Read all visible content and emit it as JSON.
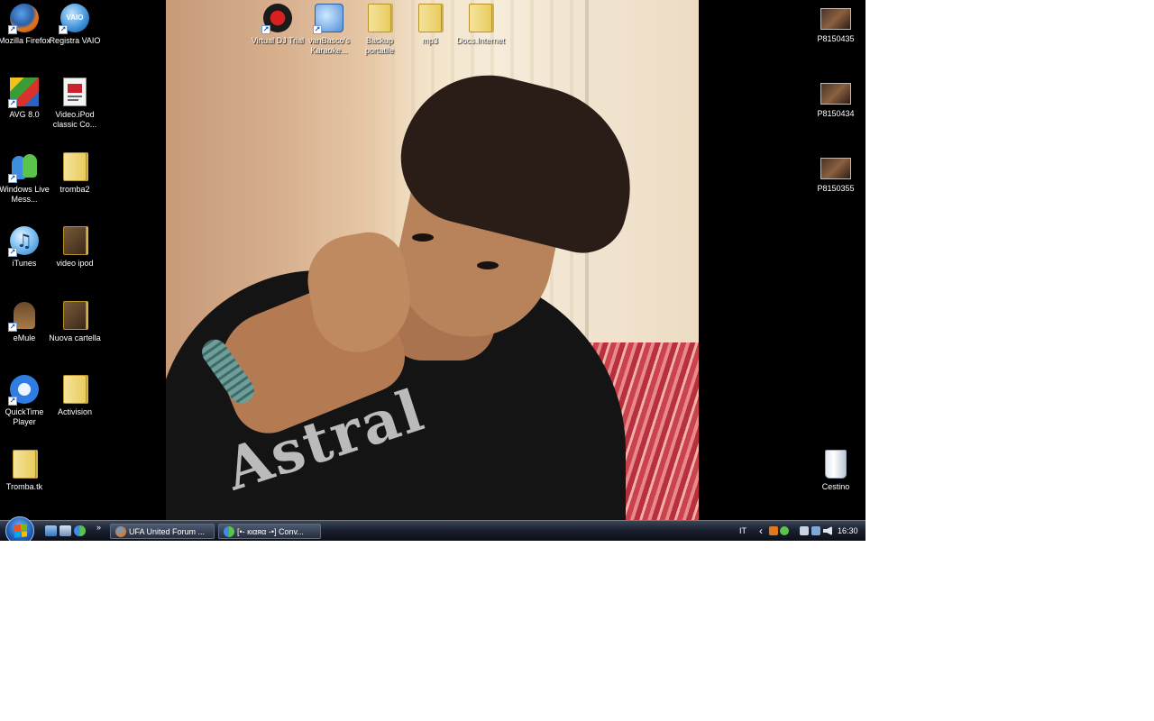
{
  "desktop": {
    "left_icons": [
      {
        "id": "firefox",
        "label": "Mozilla Firefox",
        "shortcut": true
      },
      {
        "id": "vaio",
        "label": "Registra VAIO",
        "shortcut": true
      },
      {
        "id": "avg",
        "label": "AVG 8.0",
        "shortcut": true
      },
      {
        "id": "video-ipod-classic",
        "label": "Video.iPod classic Co...",
        "shortcut": false
      },
      {
        "id": "live-messenger",
        "label": "Windows Live Mess...",
        "shortcut": true
      },
      {
        "id": "tromba2",
        "label": "tromba2",
        "shortcut": false
      },
      {
        "id": "itunes",
        "label": "iTunes",
        "shortcut": true
      },
      {
        "id": "video-ipod",
        "label": "video ipod",
        "shortcut": false
      },
      {
        "id": "emule",
        "label": "eMule",
        "shortcut": true
      },
      {
        "id": "nuova-cartella",
        "label": "Nuova cartella",
        "shortcut": false
      },
      {
        "id": "quicktime",
        "label": "QuickTime Player",
        "shortcut": true
      },
      {
        "id": "activision",
        "label": "Activision",
        "shortcut": false
      },
      {
        "id": "trombatk",
        "label": "Tromba.tk",
        "shortcut": false
      }
    ],
    "top_icons": [
      {
        "id": "virtual-dj",
        "label": "Virtual DJ Trial",
        "shortcut": true
      },
      {
        "id": "vanbasco",
        "label": "vanBasco's Karaoke...",
        "shortcut": true
      },
      {
        "id": "backup",
        "label": "Backup portatile",
        "shortcut": false
      },
      {
        "id": "mp3",
        "label": "mp3",
        "shortcut": false
      },
      {
        "id": "docs-internet",
        "label": "Docs.Internet",
        "shortcut": false
      }
    ],
    "right_icons": [
      {
        "id": "p8150435",
        "label": "P8150435"
      },
      {
        "id": "p8150434",
        "label": "P8150434"
      },
      {
        "id": "p8150355",
        "label": "P8150355"
      },
      {
        "id": "cestino",
        "label": "Cestino"
      }
    ],
    "wallpaper_shirt_text": "Astral"
  },
  "taskbar": {
    "chevron": "»",
    "buttons": [
      {
        "label": "UFA   United Forum ...",
        "icon": "firefox-icon"
      },
      {
        "label": "[•- кιαяα -•]  Conv...",
        "icon": "messenger-icon"
      }
    ],
    "language": "IT",
    "tray_expand": "‹",
    "clock": "16:30"
  }
}
